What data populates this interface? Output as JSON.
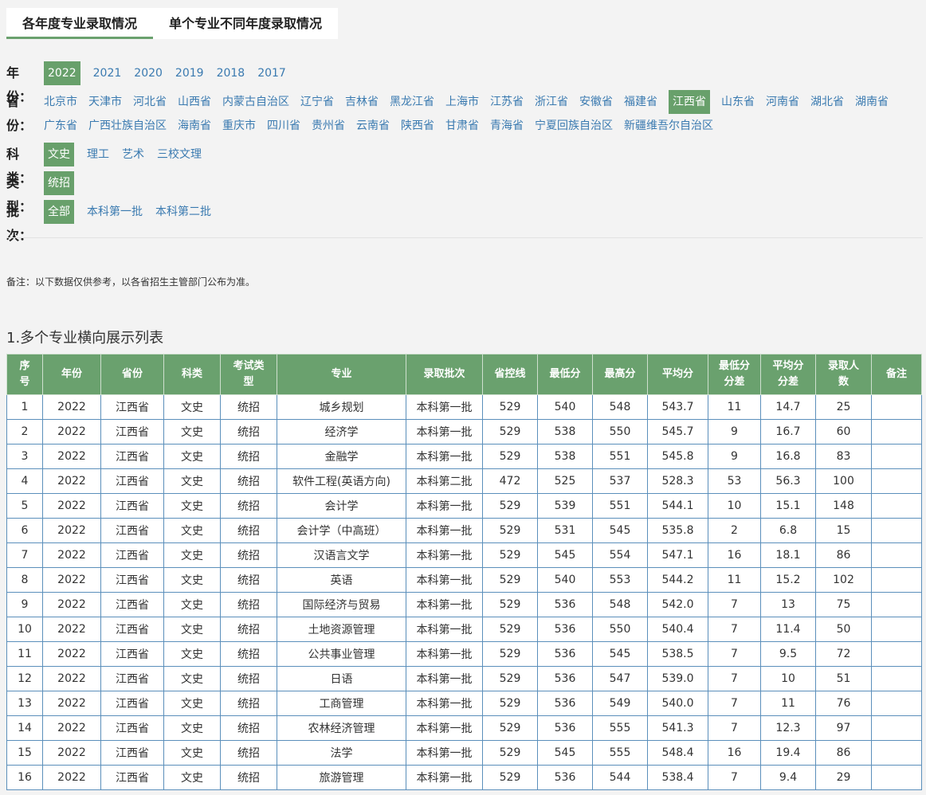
{
  "tabs": [
    {
      "label": "各年度专业录取情况",
      "active": true
    },
    {
      "label": "单个专业不同年度录取情况",
      "active": false
    }
  ],
  "filters": {
    "year": {
      "label": "年份：",
      "options": [
        "2022",
        "2021",
        "2020",
        "2019",
        "2018",
        "2017"
      ],
      "selected": "2022"
    },
    "province": {
      "label": "省份：",
      "options": [
        "北京市",
        "天津市",
        "河北省",
        "山西省",
        "内蒙古自治区",
        "辽宁省",
        "吉林省",
        "黑龙江省",
        "上海市",
        "江苏省",
        "浙江省",
        "安徽省",
        "福建省",
        "江西省",
        "山东省",
        "河南省",
        "湖北省",
        "湖南省",
        "广东省",
        "广西壮族自治区",
        "海南省",
        "重庆市",
        "四川省",
        "贵州省",
        "云南省",
        "陕西省",
        "甘肃省",
        "青海省",
        "宁夏回族自治区",
        "新疆维吾尔自治区"
      ],
      "selected": "江西省"
    },
    "subject": {
      "label": "科类：",
      "options": [
        "文史",
        "理工",
        "艺术",
        "三校文理"
      ],
      "selected": "文史"
    },
    "type": {
      "label": "类型：",
      "options": [
        "统招"
      ],
      "selected": "统招"
    },
    "batch": {
      "label": "批次：",
      "options": [
        "全部",
        "本科第一批",
        "本科第二批"
      ],
      "selected": "全部"
    }
  },
  "note": "备注：以下数据仅供参考，以各省招生主管部门公布为准。",
  "section_title": "1.多个专业横向展示列表",
  "colors": {
    "accent": "#6aa16e",
    "link": "#3a7ab0",
    "table_border": "#5b8fbb"
  },
  "table": {
    "headers": [
      "序号",
      "年份",
      "省份",
      "科类",
      "考试类型",
      "专业",
      "录取批次",
      "省控线",
      "最低分",
      "最高分",
      "平均分",
      "最低分分差",
      "平均分分差",
      "录取人数",
      "备注"
    ],
    "rows": [
      [
        "1",
        "2022",
        "江西省",
        "文史",
        "统招",
        "城乡规划",
        "本科第一批",
        "529",
        "540",
        "548",
        "543.7",
        "11",
        "14.7",
        "25",
        ""
      ],
      [
        "2",
        "2022",
        "江西省",
        "文史",
        "统招",
        "经济学",
        "本科第一批",
        "529",
        "538",
        "550",
        "545.7",
        "9",
        "16.7",
        "60",
        ""
      ],
      [
        "3",
        "2022",
        "江西省",
        "文史",
        "统招",
        "金融学",
        "本科第一批",
        "529",
        "538",
        "551",
        "545.8",
        "9",
        "16.8",
        "83",
        ""
      ],
      [
        "4",
        "2022",
        "江西省",
        "文史",
        "统招",
        "软件工程(英语方向)",
        "本科第二批",
        "472",
        "525",
        "537",
        "528.3",
        "53",
        "56.3",
        "100",
        ""
      ],
      [
        "5",
        "2022",
        "江西省",
        "文史",
        "统招",
        "会计学",
        "本科第一批",
        "529",
        "539",
        "551",
        "544.1",
        "10",
        "15.1",
        "148",
        ""
      ],
      [
        "6",
        "2022",
        "江西省",
        "文史",
        "统招",
        "会计学（中高班）",
        "本科第一批",
        "529",
        "531",
        "545",
        "535.8",
        "2",
        "6.8",
        "15",
        ""
      ],
      [
        "7",
        "2022",
        "江西省",
        "文史",
        "统招",
        "汉语言文学",
        "本科第一批",
        "529",
        "545",
        "554",
        "547.1",
        "16",
        "18.1",
        "86",
        ""
      ],
      [
        "8",
        "2022",
        "江西省",
        "文史",
        "统招",
        "英语",
        "本科第一批",
        "529",
        "540",
        "553",
        "544.2",
        "11",
        "15.2",
        "102",
        ""
      ],
      [
        "9",
        "2022",
        "江西省",
        "文史",
        "统招",
        "国际经济与贸易",
        "本科第一批",
        "529",
        "536",
        "548",
        "542.0",
        "7",
        "13",
        "75",
        ""
      ],
      [
        "10",
        "2022",
        "江西省",
        "文史",
        "统招",
        "土地资源管理",
        "本科第一批",
        "529",
        "536",
        "550",
        "540.4",
        "7",
        "11.4",
        "50",
        ""
      ],
      [
        "11",
        "2022",
        "江西省",
        "文史",
        "统招",
        "公共事业管理",
        "本科第一批",
        "529",
        "536",
        "545",
        "538.5",
        "7",
        "9.5",
        "72",
        ""
      ],
      [
        "12",
        "2022",
        "江西省",
        "文史",
        "统招",
        "日语",
        "本科第一批",
        "529",
        "536",
        "547",
        "539.0",
        "7",
        "10",
        "51",
        ""
      ],
      [
        "13",
        "2022",
        "江西省",
        "文史",
        "统招",
        "工商管理",
        "本科第一批",
        "529",
        "536",
        "549",
        "540.0",
        "7",
        "11",
        "76",
        ""
      ],
      [
        "14",
        "2022",
        "江西省",
        "文史",
        "统招",
        "农林经济管理",
        "本科第一批",
        "529",
        "536",
        "555",
        "541.3",
        "7",
        "12.3",
        "97",
        ""
      ],
      [
        "15",
        "2022",
        "江西省",
        "文史",
        "统招",
        "法学",
        "本科第一批",
        "529",
        "545",
        "555",
        "548.4",
        "16",
        "19.4",
        "86",
        ""
      ],
      [
        "16",
        "2022",
        "江西省",
        "文史",
        "统招",
        "旅游管理",
        "本科第一批",
        "529",
        "536",
        "544",
        "538.4",
        "7",
        "9.4",
        "29",
        ""
      ]
    ]
  }
}
